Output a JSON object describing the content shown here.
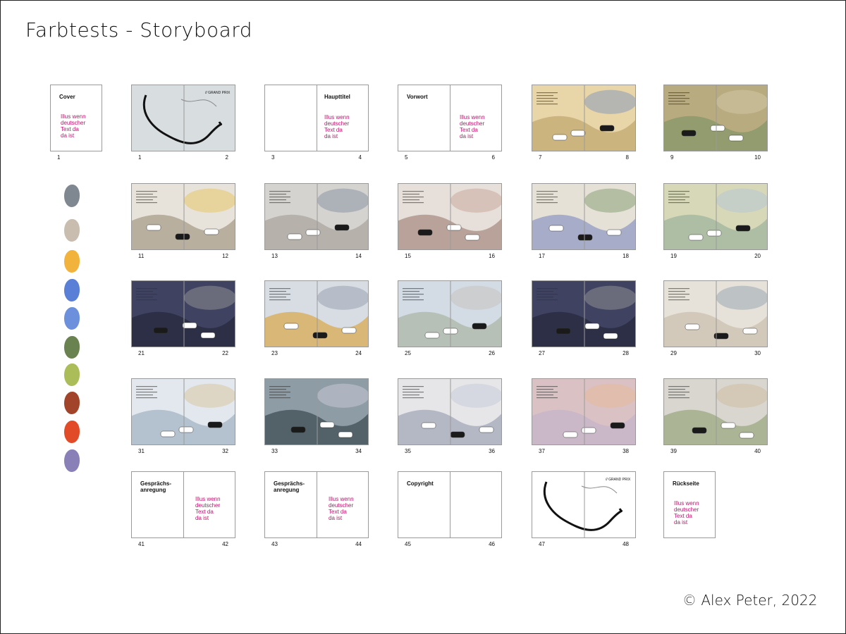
{
  "title": "Farbtests - Storyboard",
  "copyright": "© Alex Peter, 2022",
  "palette": [
    "#7f8790",
    "#c9bdb0",
    "#f2b33d",
    "#5a7fd6",
    "#6d90dd",
    "#6a8250",
    "#aabd58",
    "#a2442a",
    "#e24b27",
    "#8a80b8"
  ],
  "text_spreads": [
    {
      "id": "cover",
      "left_page": "1",
      "title": "Cover",
      "note": "Illus wenn\ndeutscher\nText da\nda ist"
    },
    {
      "id": "s3",
      "left_page": "3",
      "right_page": "4",
      "title": "Haupttitel",
      "note": "Illus wenn\ndeutscher\nText da\nda ist"
    },
    {
      "id": "s5",
      "left_page": "5",
      "right_page": "6",
      "title": "Vorwort",
      "note": "Illus wenn\ndeutscher\nText da\nda ist"
    },
    {
      "id": "s41",
      "left_page": "41",
      "right_page": "42",
      "title": "Gesprächs-\nanregung",
      "note": "Illus wenn\ndeutscher\nText da\nda ist"
    },
    {
      "id": "s43",
      "left_page": "43",
      "right_page": "44",
      "title": "Gesprächs-\nanregung",
      "note": "Illus wenn\ndeutscher\nText da\nda ist"
    },
    {
      "id": "s45",
      "left_page": "45",
      "right_page": "46",
      "title": "Copyright"
    },
    {
      "id": "back",
      "left_page": "",
      "title": "Rückseite",
      "note": "Illus wenn\ndeutscher\nText da\nda ist"
    }
  ],
  "illustrated_spreads": [
    {
      "id": "s1",
      "left_page": "1",
      "right_page": "2",
      "label": "// GRAND PRIX",
      "colors": [
        "#d8dde0",
        "#b7c9d6",
        "#9aa9b5"
      ]
    },
    {
      "id": "s7",
      "left_page": "7",
      "right_page": "8",
      "colors": [
        "#e8d5a8",
        "#c9b07a",
        "#8a9ab8"
      ]
    },
    {
      "id": "s9",
      "left_page": "9",
      "right_page": "10",
      "colors": [
        "#b9ab80",
        "#8e9a6b",
        "#d2c7a4"
      ]
    },
    {
      "id": "s11",
      "left_page": "11",
      "right_page": "12",
      "colors": [
        "#e8e3da",
        "#b3a898",
        "#e6c66a"
      ]
    },
    {
      "id": "s13",
      "left_page": "13",
      "right_page": "14",
      "colors": [
        "#d5d3cf",
        "#b3aea6",
        "#8c97a8"
      ]
    },
    {
      "id": "s15",
      "left_page": "15",
      "right_page": "16",
      "colors": [
        "#e7dfd9",
        "#b29b92",
        "#c9a99c"
      ]
    },
    {
      "id": "s17",
      "left_page": "17",
      "right_page": "18",
      "colors": [
        "#e6e1d6",
        "#a0a7c6",
        "#88a27a"
      ]
    },
    {
      "id": "s19",
      "left_page": "19",
      "right_page": "20",
      "colors": [
        "#d6d8b8",
        "#a9bba3",
        "#b8c7d4"
      ]
    },
    {
      "id": "s21",
      "left_page": "21",
      "right_page": "22",
      "colors": [
        "#3f4260",
        "#2a2d44",
        "#8e8e92"
      ]
    },
    {
      "id": "s23",
      "left_page": "23",
      "right_page": "24",
      "colors": [
        "#d7dde3",
        "#d9b36a",
        "#9aa3b5"
      ]
    },
    {
      "id": "s25",
      "left_page": "25",
      "right_page": "26",
      "colors": [
        "#d3dbe4",
        "#b2bcb0",
        "#c7c2c0"
      ]
    },
    {
      "id": "s27",
      "left_page": "27",
      "right_page": "28",
      "colors": [
        "#3f4260",
        "#2a2d44",
        "#8e8e92"
      ]
    },
    {
      "id": "s29",
      "left_page": "29",
      "right_page": "30",
      "colors": [
        "#e6e2d9",
        "#cfc6b6",
        "#9aa7b2"
      ]
    },
    {
      "id": "s31",
      "left_page": "31",
      "right_page": "32",
      "colors": [
        "#e3e8ee",
        "#aebccb",
        "#d8c6a4"
      ]
    },
    {
      "id": "s33",
      "left_page": "33",
      "right_page": "34",
      "colors": [
        "#8e9ca6",
        "#4c5b63",
        "#c6c8d6"
      ]
    },
    {
      "id": "s35",
      "left_page": "35",
      "right_page": "36",
      "colors": [
        "#e6e6e8",
        "#aeb3c0",
        "#c6ccd8"
      ]
    },
    {
      "id": "s37",
      "left_page": "37",
      "right_page": "38",
      "colors": [
        "#d9c1c4",
        "#c8b6c8",
        "#e6b99a"
      ]
    },
    {
      "id": "s39",
      "left_page": "39",
      "right_page": "40",
      "colors": [
        "#d8d6cf",
        "#a7b08f",
        "#d2bfa4"
      ]
    },
    {
      "id": "s47",
      "left_page": "47",
      "right_page": "48",
      "label": "// GRAND PRIX",
      "colors": [
        "#ffffff",
        "#eeeeee",
        "#cccccc"
      ]
    }
  ]
}
